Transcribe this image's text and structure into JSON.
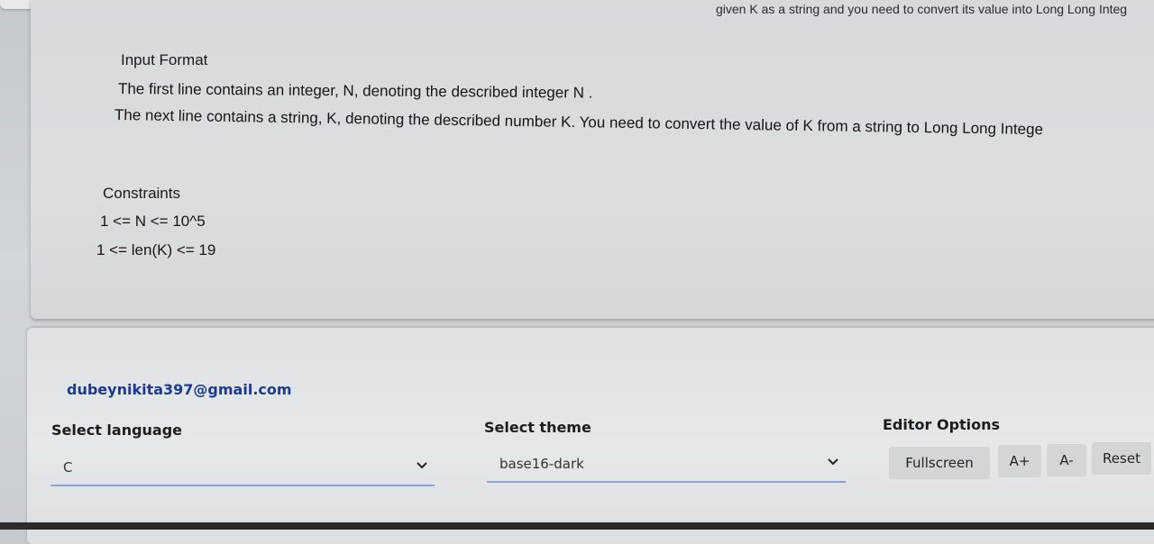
{
  "problem": {
    "intro_fragment": "given K as a string and you need to convert its value into Long Long Integ",
    "input_format": {
      "heading": "Input Format",
      "lines": [
        "The first line contains an integer, N, denoting the described integer N .",
        "The next line contains a string, K, denoting the described number K. You need to convert the value of K from a string to Long Long Intege"
      ]
    },
    "constraints": {
      "heading": "Constraints",
      "lines": [
        "1 <= N <= 10^5",
        "1 <= len(K) <= 19"
      ]
    }
  },
  "editor": {
    "user_email": "dubeynikita397@gmail.com",
    "language": {
      "label": "Select language",
      "value": "C"
    },
    "theme": {
      "label": "Select theme",
      "value": "base16-dark"
    },
    "options": {
      "label": "Editor Options",
      "fullscreen": "Fullscreen",
      "font_increase": "A+",
      "font_decrease": "A-",
      "reset": "Reset"
    }
  }
}
